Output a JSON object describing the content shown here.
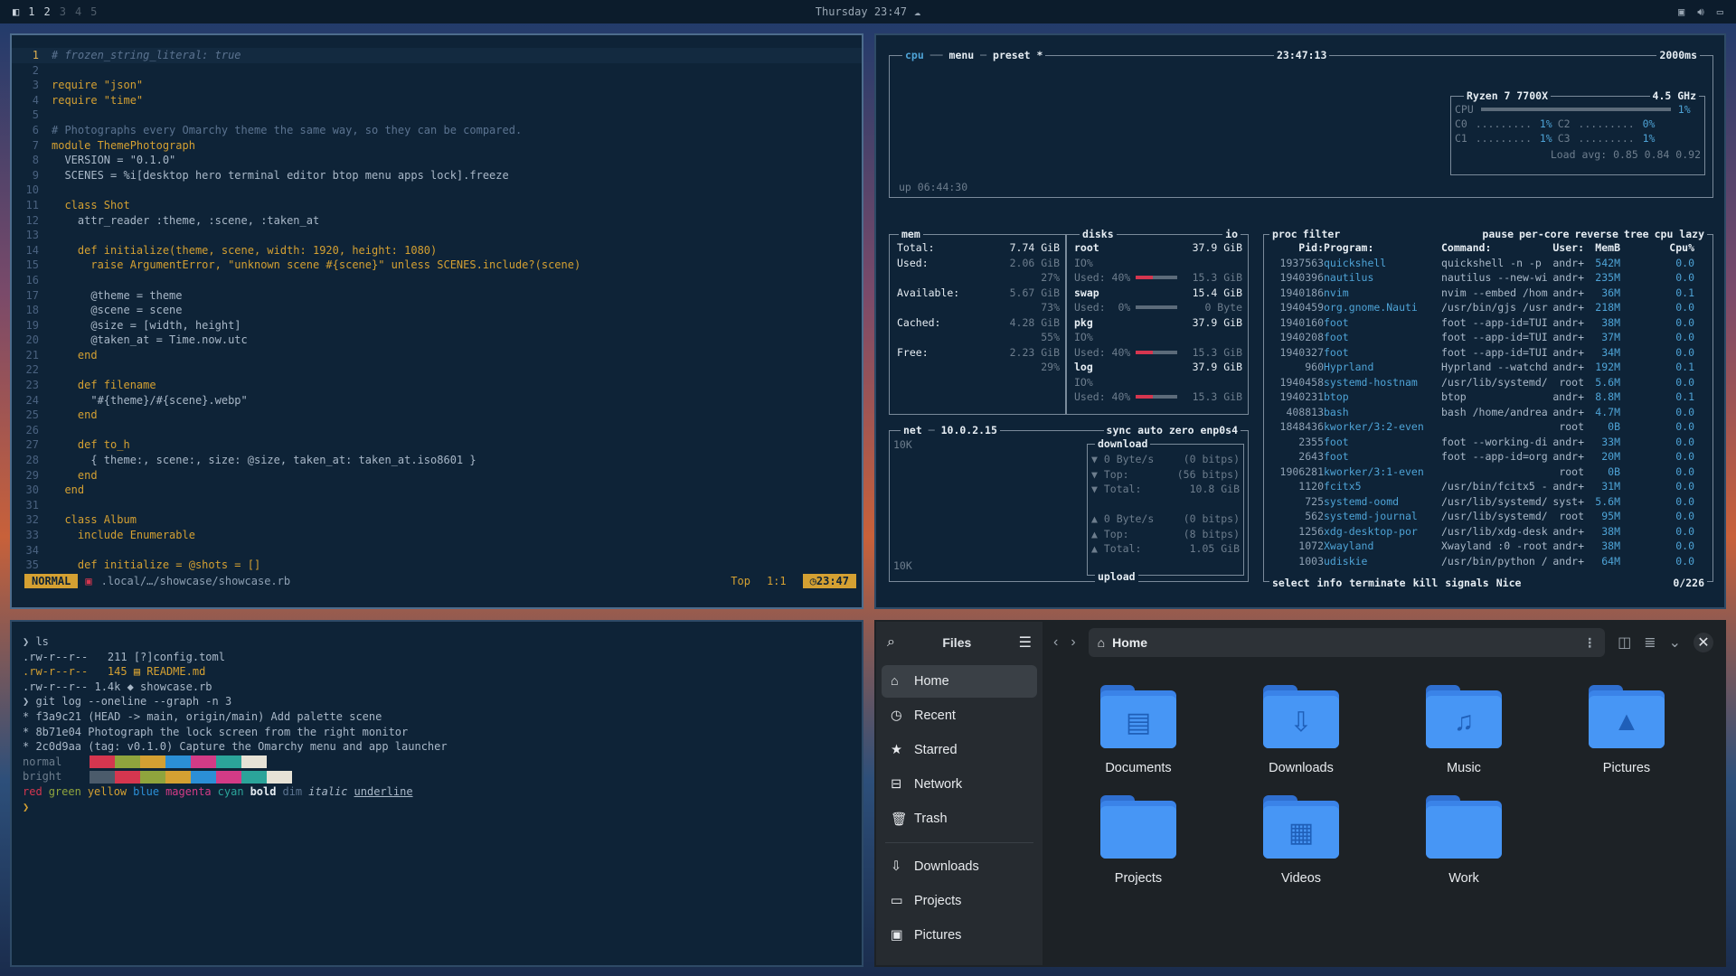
{
  "topbar": {
    "workspaces": [
      "1",
      "2",
      "3",
      "4",
      "5"
    ],
    "clock": "Thursday 23:47"
  },
  "editor": {
    "lines": [
      "# frozen_string_literal: true",
      "",
      "require \"json\"",
      "require \"time\"",
      "",
      "# Photographs every Omarchy theme the same way, so they can be compared.",
      "module ThemePhotograph",
      "  VERSION = \"0.1.0\"",
      "  SCENES = %i[desktop hero terminal editor btop menu apps lock].freeze",
      "",
      "  class Shot",
      "    attr_reader :theme, :scene, :taken_at",
      "",
      "    def initialize(theme, scene, width: 1920, height: 1080)",
      "      raise ArgumentError, \"unknown scene #{scene}\" unless SCENES.include?(scene)",
      "",
      "      @theme = theme",
      "      @scene = scene",
      "      @size = [width, height]",
      "      @taken_at = Time.now.utc",
      "    end",
      "",
      "    def filename",
      "      \"#{theme}/#{scene}.webp\"",
      "    end",
      "",
      "    def to_h",
      "      { theme:, scene:, size: @size, taken_at: taken_at.iso8601 }",
      "    end",
      "  end",
      "",
      "  class Album",
      "    include Enumerable",
      "",
      "    def initialize = @shots = []"
    ],
    "status": {
      "mode": "NORMAL",
      "path": ".local/…/showcase/showcase.rb",
      "position": "Top",
      "cursor": "1:1",
      "time": "23:47"
    }
  },
  "btop": {
    "cpu_box": {
      "tabs": [
        "cpu",
        "menu",
        "preset *"
      ],
      "clock": "23:47:13",
      "interval": "2000ms",
      "uptime": "up 06:44:30",
      "model": "Ryzen 7 7700X",
      "freq": "4.5 GHz",
      "cpu_label": "CPU",
      "cpu_pct": "1%",
      "cores": [
        {
          "name": "C0",
          "pct": "1%"
        },
        {
          "name": "C2",
          "pct": "0%"
        },
        {
          "name": "C1",
          "pct": "1%"
        },
        {
          "name": "C3",
          "pct": "1%"
        }
      ],
      "load_avg": "Load avg: 0.85 0.84 0.92"
    },
    "mem_box": {
      "title": "mem",
      "rows": [
        {
          "label": "Total:",
          "value": "7.74 GiB"
        },
        {
          "label": "Used:",
          "value": "2.06 GiB"
        },
        {
          "label": "",
          "value": "27%"
        },
        {
          "label": "Available:",
          "value": "5.67 GiB"
        },
        {
          "label": "",
          "value": "73%"
        },
        {
          "label": "Cached:",
          "value": "4.28 GiB"
        },
        {
          "label": "",
          "value": "55%"
        },
        {
          "label": "Free:",
          "value": "2.23 GiB"
        },
        {
          "label": "",
          "value": "29%"
        }
      ]
    },
    "disks_box": {
      "title": "disks",
      "io": "io",
      "disks": [
        {
          "name": "root",
          "size": "37.9 GiB",
          "io": "IO%",
          "used": "Used: 40%",
          "total": "15.3 GiB",
          "fill": 0.4
        },
        {
          "name": "swap",
          "size": "15.4 GiB",
          "io": "",
          "used": "Used:  0%",
          "total": "0 Byte",
          "fill": 0.0
        },
        {
          "name": "pkg",
          "size": "37.9 GiB",
          "io": "IO%",
          "used": "Used: 40%",
          "total": "15.3 GiB",
          "fill": 0.4
        },
        {
          "name": "log",
          "size": "37.9 GiB",
          "io": "IO%",
          "used": "Used: 40%",
          "total": "15.3 GiB",
          "fill": 0.4
        }
      ]
    },
    "net_box": {
      "title": "net",
      "ip": "10.0.2.15",
      "tabs": [
        "sync",
        "auto",
        "zero",
        "enp0s4"
      ],
      "scale_top": "10K",
      "scale_bottom": "10K",
      "download": {
        "label": "download",
        "rate": "0 Byte/s",
        "rate_bits": "(0 bitps)",
        "top": "Top:",
        "top_bits": "(56 bitps)",
        "total": "Total:",
        "total_val": "10.8 GiB"
      },
      "upload": {
        "label": "upload",
        "rate": "0 Byte/s",
        "rate_bits": "(0 bitps)",
        "top": "Top:",
        "top_bits": "(8 bitps)",
        "total": "Total:",
        "total_val": "1.05 GiB"
      }
    },
    "proc_box": {
      "tabs": [
        "proc",
        "filter",
        "pause",
        "per-core",
        "reverse",
        "tree",
        "cpu lazy"
      ],
      "headers": [
        "Pid:",
        "Program:",
        "Command:",
        "User:",
        "MemB",
        "Cpu%"
      ],
      "rows": [
        [
          "1937563",
          "quickshell",
          "quickshell -n -p /",
          "andr+",
          "542M",
          "0.0"
        ],
        [
          "1940396",
          "nautilus",
          "nautilus --new-win",
          "andr+",
          "235M",
          "0.0"
        ],
        [
          "1940186",
          "nvim",
          "nvim --embed /home",
          "andr+",
          "36M",
          "0.1"
        ],
        [
          "1940459",
          "org.gnome.Nauti",
          "/usr/bin/gjs /usr/",
          "andr+",
          "218M",
          "0.0"
        ],
        [
          "1940160",
          "foot",
          "foot --app-id=TUI.",
          "andr+",
          "38M",
          "0.0"
        ],
        [
          "1940208",
          "foot",
          "foot --app-id=TUI.",
          "andr+",
          "37M",
          "0.0"
        ],
        [
          "1940327",
          "foot",
          "foot --app-id=TUI.",
          "andr+",
          "34M",
          "0.0"
        ],
        [
          "960",
          "Hyprland",
          "Hyprland --watchdo",
          "andr+",
          "192M",
          "0.1"
        ],
        [
          "1940458",
          "systemd-hostnam",
          "/usr/lib/systemd/s",
          "root",
          "5.6M",
          "0.0"
        ],
        [
          "1940231",
          "btop",
          "btop",
          "andr+",
          "8.8M",
          "0.1"
        ],
        [
          "408813",
          "bash",
          "bash /home/andreas",
          "andr+",
          "4.7M",
          "0.0"
        ],
        [
          "1848436",
          "kworker/3:2-even",
          "",
          "root",
          "0B",
          "0.0"
        ],
        [
          "2355",
          "foot",
          "foot --working-dir",
          "andr+",
          "33M",
          "0.0"
        ],
        [
          "2643",
          "foot",
          "foot --app-id=org.",
          "andr+",
          "20M",
          "0.0"
        ],
        [
          "1906281",
          "kworker/3:1-even",
          "",
          "root",
          "0B",
          "0.0"
        ],
        [
          "1120",
          "fcitx5",
          "/usr/bin/fcitx5 --",
          "andr+",
          "31M",
          "0.0"
        ],
        [
          "725",
          "systemd-oomd",
          "/usr/lib/systemd/s",
          "syst+",
          "5.6M",
          "0.0"
        ],
        [
          "562",
          "systemd-journal",
          "/usr/lib/systemd/s",
          "root",
          "95M",
          "0.0"
        ],
        [
          "1256",
          "xdg-desktop-por",
          "/usr/lib/xdg-deskt",
          "andr+",
          "38M",
          "0.0"
        ],
        [
          "1072",
          "Xwayland",
          "Xwayland :0 -rootl",
          "andr+",
          "38M",
          "0.0"
        ],
        [
          "1003",
          "udiskie",
          "/usr/bin/python /u",
          "andr+",
          "64M",
          "0.0"
        ]
      ],
      "footer": [
        "select",
        "info",
        "terminate",
        "kill",
        "signals",
        "Nice"
      ],
      "count": "0/226"
    }
  },
  "terminal": {
    "lines": [
      {
        "t": "❯ ls",
        "c": "#a9b8c8"
      },
      {
        "t": ".rw-r--r--   211 [?]config.toml",
        "c": "#a9b8c8"
      },
      {
        "t": ".rw-r--r--   145 ▤ README.md",
        "c": "#d4a032"
      },
      {
        "t": ".rw-r--r-- 1.4k ◆ showcase.rb",
        "c": "#a9b8c8"
      },
      {
        "t": "❯ git log --oneline --graph -n 3",
        "c": "#a9b8c8"
      },
      {
        "t": "* f3a9c21 (HEAD -> main, origin/main) Add palette scene",
        "c": "#a9b8c8"
      },
      {
        "t": "* 8b71e04 Photograph the lock screen from the right monitor",
        "c": "#a9b8c8"
      },
      {
        "t": "* 2c0d9aa (tag: v0.1.0) Capture the Omarchy menu and app launcher",
        "c": "#a9b8c8"
      }
    ],
    "palette_labels": [
      "normal",
      "bright"
    ],
    "palette_colors": [
      "#0e2337",
      "#d5364f",
      "#8fa43d",
      "#d4a032",
      "#2b8fd6",
      "#d33b86",
      "#2ba49a",
      "#e6e2d6"
    ],
    "styles_line": [
      "red",
      "green",
      "yellow",
      "blue",
      "magenta",
      "cyan",
      "bold",
      "dim",
      "italic",
      "underline"
    ],
    "prompt": "❯"
  },
  "files": {
    "sidebar_title": "Files",
    "places": [
      "Home",
      "Recent",
      "Starred",
      "Network",
      "Trash"
    ],
    "bookmarks": [
      "Downloads",
      "Projects",
      "Pictures"
    ],
    "path": "Home",
    "folders": [
      {
        "name": "Documents",
        "icon": "document-icon"
      },
      {
        "name": "Downloads",
        "icon": "download-icon"
      },
      {
        "name": "Music",
        "icon": "music-icon"
      },
      {
        "name": "Pictures",
        "icon": "image-icon"
      },
      {
        "name": "Projects",
        "icon": ""
      },
      {
        "name": "Videos",
        "icon": "film-icon"
      },
      {
        "name": "Work",
        "icon": ""
      }
    ]
  }
}
